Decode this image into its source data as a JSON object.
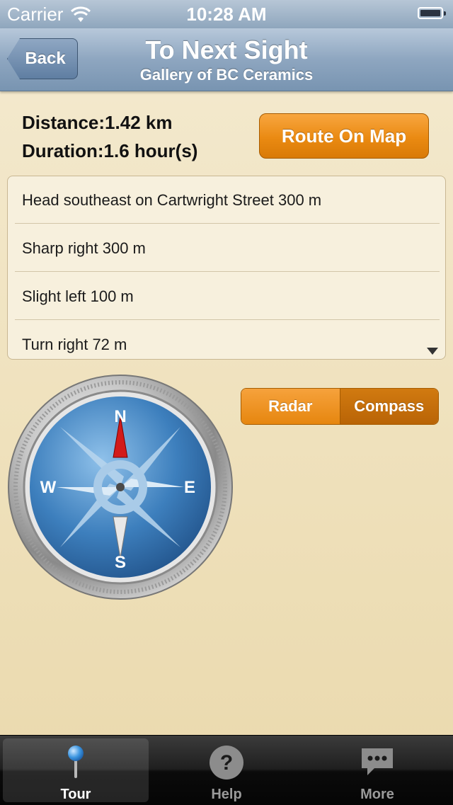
{
  "status_bar": {
    "carrier": "Carrier",
    "time": "10:28 AM"
  },
  "nav": {
    "back_label": "Back",
    "title": "To Next Sight",
    "subtitle": "Gallery of BC Ceramics"
  },
  "info": {
    "distance_label": "Distance:",
    "distance_value": "1.42 km",
    "duration_label": "Duration:",
    "duration_value": "1.6 hour(s)"
  },
  "route_button": "Route On Map",
  "directions": [
    {
      "text": "Head southeast on Cartwright Street 300 m"
    },
    {
      "text": "Sharp right 300 m"
    },
    {
      "text": "Slight left 100 m"
    },
    {
      "text": "Turn right 72 m"
    }
  ],
  "segmented": {
    "radar": "Radar",
    "compass": "Compass",
    "selected": "Compass"
  },
  "compass_dial": {
    "north": "N",
    "south": "S",
    "east": "E",
    "west": "W"
  },
  "tabs": [
    {
      "label": "Tour",
      "icon": "map-pin-icon",
      "active": true
    },
    {
      "label": "Help",
      "icon": "question-icon",
      "active": false
    },
    {
      "label": "More",
      "icon": "chat-bubble-icon",
      "active": false
    }
  ],
  "colors": {
    "accent_orange": "#ea8a12",
    "nav_blue": "#7894b1",
    "background": "#f0e3c2"
  }
}
